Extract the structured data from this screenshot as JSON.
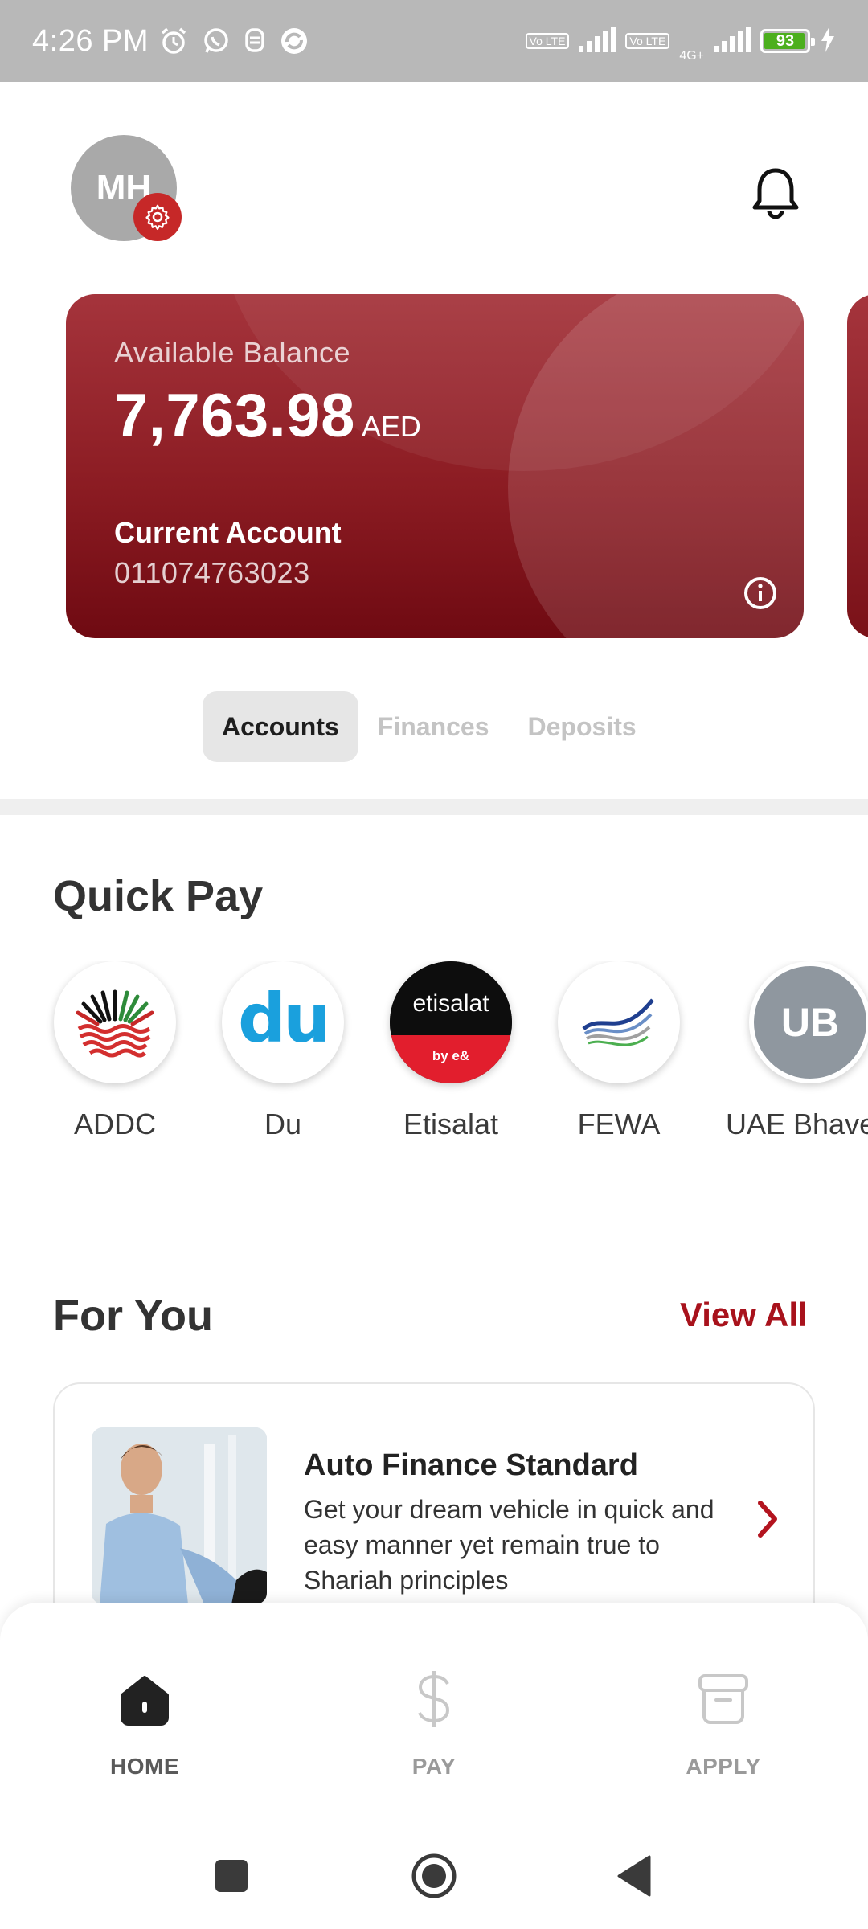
{
  "status_bar": {
    "time": "4:26 PM",
    "network_tag_1": "Vo LTE",
    "network_tag_2": "Vo LTE",
    "network_type": "4G+",
    "battery": "93",
    "icons": [
      "alarm-icon",
      "whatsapp-icon",
      "notification-icon",
      "sync-icon",
      "signal-icon",
      "charging-icon"
    ]
  },
  "header": {
    "avatar_initials": "MH",
    "icons": [
      "settings-icon",
      "bell-icon"
    ]
  },
  "balance_card": {
    "label": "Available Balance",
    "amount": "7,763.98",
    "currency": "AED",
    "account_type": "Current Account",
    "account_number": "011074763023",
    "colors": {
      "card_top": "#a5343c",
      "card_bottom": "#6f0a12"
    }
  },
  "tabs": [
    {
      "label": "Accounts",
      "active": true
    },
    {
      "label": "Finances",
      "active": false
    },
    {
      "label": "Deposits",
      "active": false
    }
  ],
  "quick_pay": {
    "title": "Quick Pay",
    "items": [
      {
        "label": "ADDC"
      },
      {
        "label": "Du",
        "logo_text": "du"
      },
      {
        "label": "Etisalat",
        "logo_text": "etisalat",
        "logo_subtext": "by e&"
      },
      {
        "label": "FEWA"
      },
      {
        "label": "UAE Bhave",
        "logo_text": "UB"
      }
    ]
  },
  "for_you": {
    "title": "For You",
    "view_all": "View All",
    "card": {
      "title": "Auto Finance Standard",
      "description": "Get your dream vehicle in quick and easy manner yet remain true to Shariah principles"
    }
  },
  "bottom_nav": {
    "items": [
      {
        "label": "HOME",
        "icon": "home-icon",
        "active": true
      },
      {
        "label": "PAY",
        "icon": "dollar-icon",
        "active": false
      },
      {
        "label": "APPLY",
        "icon": "archive-icon",
        "active": false
      }
    ]
  },
  "system_nav": [
    "recents-button",
    "home-button",
    "back-button"
  ],
  "colors": {
    "accent": "#a8121c",
    "status_bar": "#b8b8b8",
    "battery_fill": "#4caf1e"
  }
}
